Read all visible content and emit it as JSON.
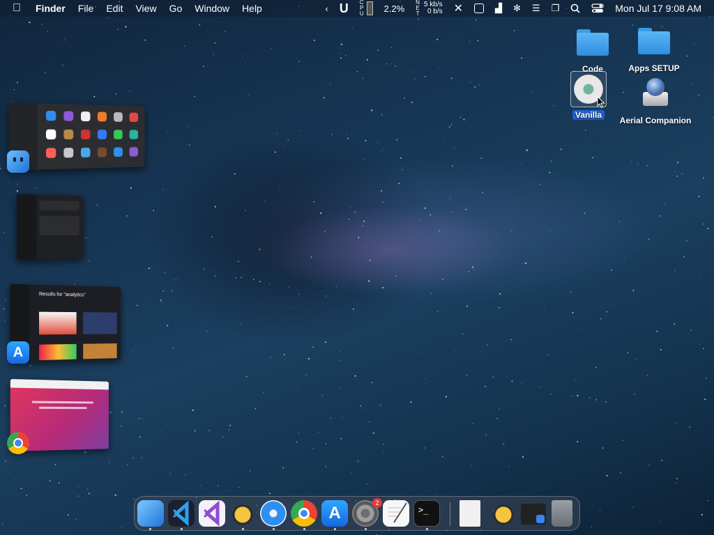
{
  "menubar": {
    "app_name": "Finder",
    "menus": [
      "File",
      "Edit",
      "View",
      "Go",
      "Window",
      "Help"
    ],
    "status": {
      "cpu_label_chars": [
        "C",
        "P",
        "U"
      ],
      "cpu_percent": "2.2%",
      "net_label_chars": [
        "N",
        "E",
        "T"
      ],
      "net_up": "5 kb/s",
      "net_down": "0 b/s",
      "clock": "Mon Jul 17  9:08 AM"
    }
  },
  "desktop_items": {
    "code": "Code",
    "apps_setup": "Apps SETUP",
    "vanilla": "Vanilla",
    "aerial": "Aerial Companion"
  },
  "stage_manager": {
    "window3_title": "Results for \"analytics\""
  },
  "dock": {
    "settings_badge": "2"
  },
  "colors": {
    "folder_blue": "#3a9be6",
    "selection_blue": "#1f5fce",
    "badge_red": "#e5383b",
    "menubar_bg": "#0e1e30"
  }
}
